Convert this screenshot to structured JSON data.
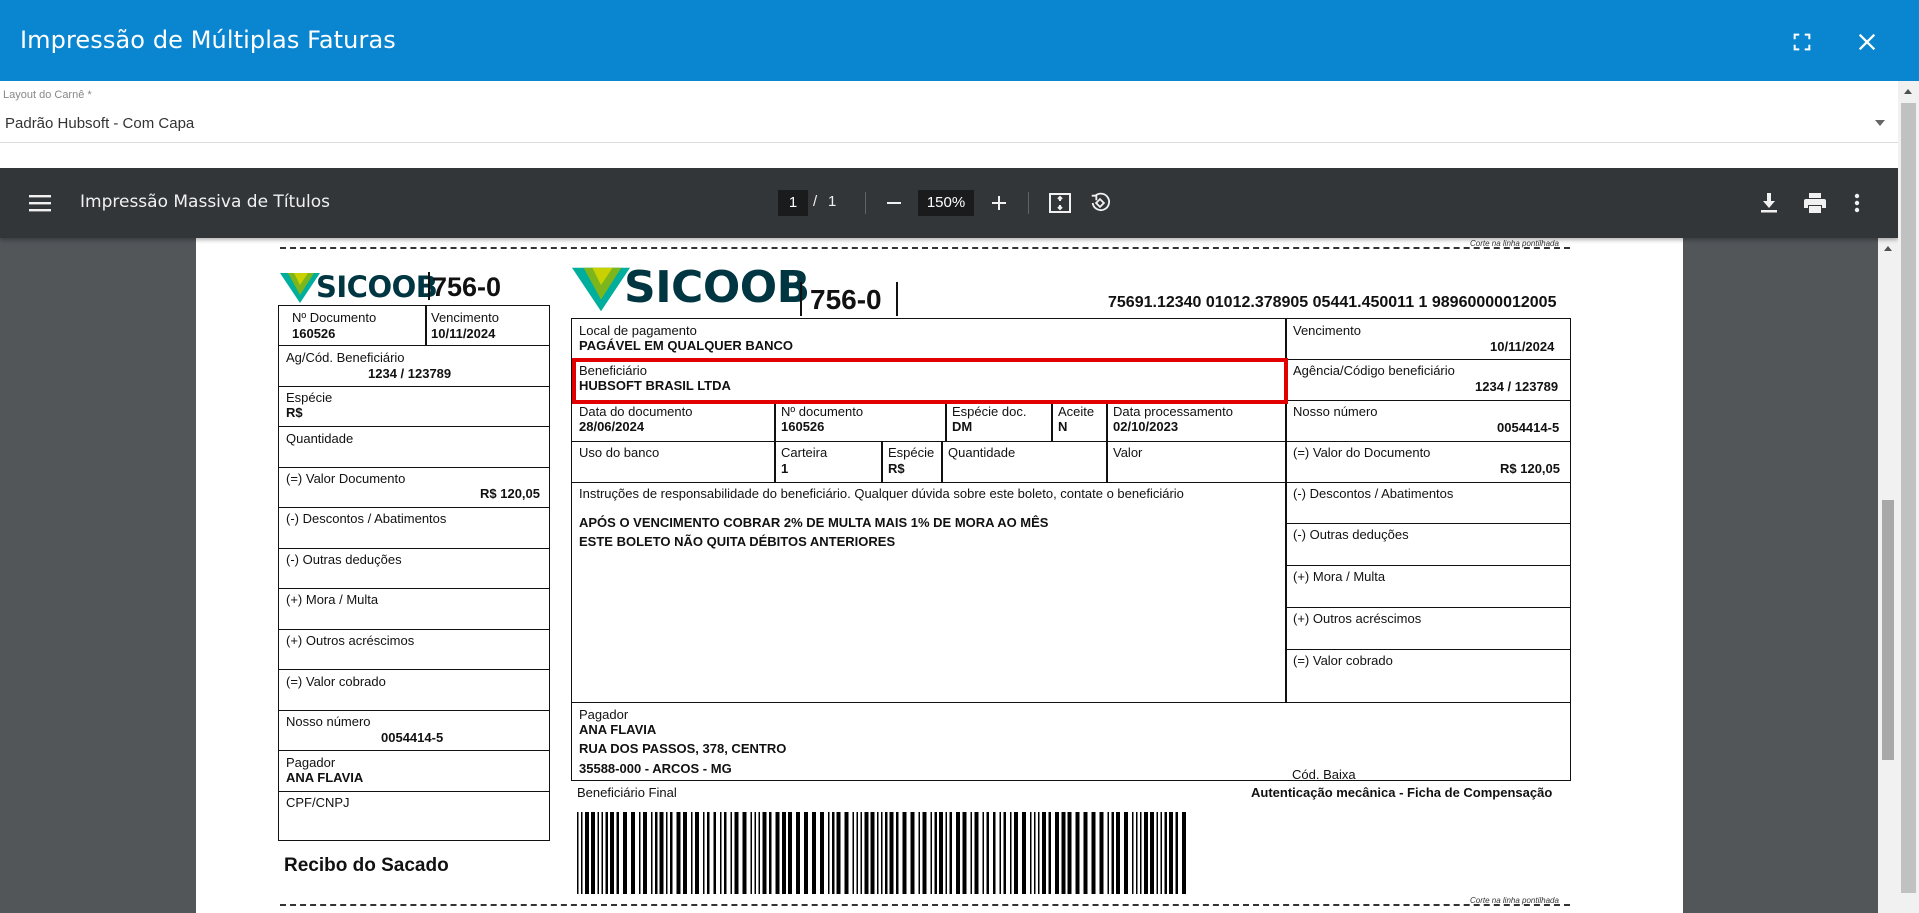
{
  "dialog": {
    "title": "Impressão de Múltiplas Faturas"
  },
  "layout_field": {
    "label": "Layout do Carnê *",
    "value": "Padrão Hubsoft - Com Capa"
  },
  "pdf_toolbar": {
    "title": "Impressão Massiva de Títulos",
    "current_page": "1",
    "page_separator": "/",
    "total_pages": "1",
    "zoom": "150%"
  },
  "boleto": {
    "cut_line_text": "Corte na linha pontilhada",
    "bank_name": "SICOOB",
    "bank_code": "756-0",
    "digitable_line": "75691.12340 01012.378905 05441.450011 1 98960000012005",
    "receipt": {
      "doc_number_label": "Nº Documento",
      "doc_number": "160526",
      "due_label": "Vencimento",
      "due_date": "10/11/2024",
      "agency_label": "Ag/Cód. Beneficiário",
      "agency": "1234 / 123789",
      "species_label": "Espécie",
      "species": "R$",
      "quantity_label": "Quantidade",
      "doc_value_label": "(=) Valor Documento",
      "doc_value": "R$ 120,05",
      "discounts_label": "(-) Descontos / Abatimentos",
      "other_deductions_label": "(-) Outras deduções",
      "fine_label": "(+) Mora / Multa",
      "other_additions_label": "(+) Outros acréscimos",
      "charged_label": "(=) Valor cobrado",
      "our_number_label": "Nosso número",
      "our_number": "0054414-5",
      "payer_label": "Pagador",
      "payer": "ANA FLAVIA",
      "cpf_label": "CPF/CNPJ",
      "footer": "Recibo do Sacado"
    },
    "main": {
      "payment_place_label": "Local de pagamento",
      "payment_place": "PAGÁVEL EM QUALQUER BANCO",
      "due_label": "Vencimento",
      "due_date": "10/11/2024",
      "beneficiary_label": "Beneficiário",
      "beneficiary": "HUBSOFT BRASIL LTDA",
      "agency_label": "Agência/Código beneficiário",
      "agency": "1234 / 123789",
      "doc_date_label": "Data do documento",
      "doc_date": "28/06/2024",
      "doc_number_label": "Nº documento",
      "doc_number": "160526",
      "doc_species_label": "Espécie doc.",
      "doc_species": "DM",
      "accept_label": "Aceite",
      "accept": "N",
      "processing_date_label": "Data processamento",
      "processing_date": "02/10/2023",
      "our_number_label": "Nosso número",
      "our_number": "0054414-5",
      "bank_use_label": "Uso do banco",
      "wallet_label": "Carteira",
      "wallet": "1",
      "species_label": "Espécie",
      "species": "R$",
      "quantity_label": "Quantidade",
      "value_label": "Valor",
      "doc_value_label": "(=) Valor do Documento",
      "doc_value": "R$ 120,05",
      "instructions_header": "Instruções de responsabilidade do beneficiário. Qualquer dúvida sobre este boleto, contate o beneficiário",
      "instruction_1": "APÓS O VENCIMENTO COBRAR 2% DE MULTA MAIS 1% DE MORA AO MÊS",
      "instruction_2": "ESTE BOLETO NÃO QUITA DÉBITOS ANTERIORES",
      "discounts_label": "(-) Descontos / Abatimentos",
      "other_deductions_label": "(-) Outras deduções",
      "fine_label": "(+) Mora / Multa",
      "other_additions_label": "(+) Outros acréscimos",
      "charged_label": "(=) Valor cobrado",
      "payer_label": "Pagador",
      "payer_name": "ANA FLAVIA",
      "payer_address": "RUA DOS PASSOS, 378, CENTRO",
      "payer_city": "35588-000 - ARCOS - MG",
      "cod_baixa_label": "Cód. Baixa",
      "final_beneficiary_label": "Beneficiário Final",
      "authentication_label": "Autenticação mecânica - Ficha de Compensação"
    }
  },
  "colors": {
    "header": "#0a86d1",
    "pdf_toolbar": "#323639",
    "viewer_bg": "#525659",
    "highlight": "#e00000",
    "logo_dark": "#003641",
    "logo_green": "#7db61c"
  },
  "icons": {
    "fullscreen": "fullscreen-icon",
    "close": "close-icon",
    "menu": "menu-icon",
    "zoom_out": "minus-icon",
    "zoom_in": "plus-icon",
    "fit": "fit-page-icon",
    "rotate": "rotate-icon",
    "download": "download-icon",
    "print": "print-icon",
    "more": "more-vert-icon"
  }
}
